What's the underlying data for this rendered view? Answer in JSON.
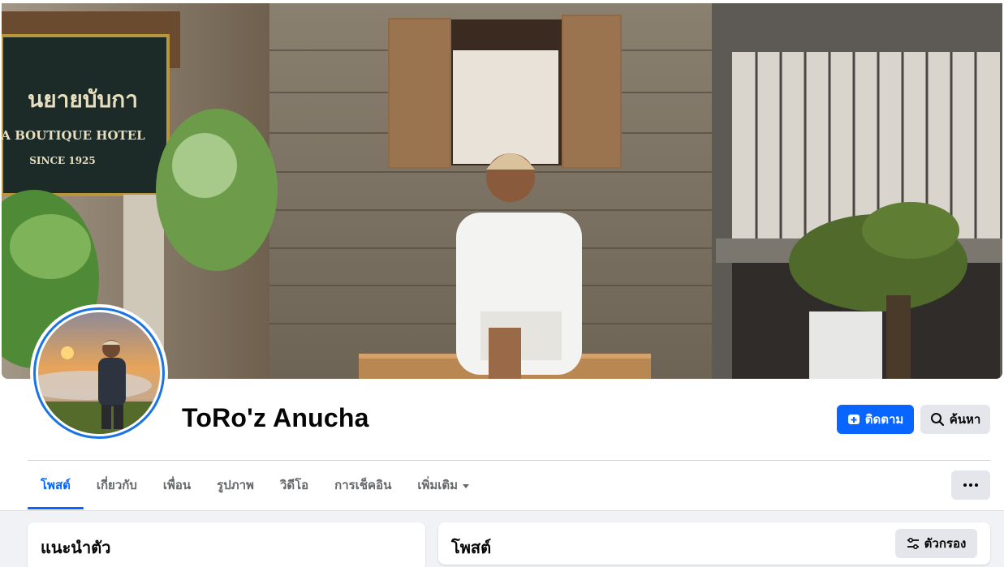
{
  "profile": {
    "name": "ToRo'z Anucha",
    "cover_sign": {
      "line1": "นยายบับกา",
      "line2": "A BOUTIQUE HOTEL",
      "line3": "SINCE 1925"
    }
  },
  "actions": {
    "follow_label": "ติดตาม",
    "search_label": "ค้นหา"
  },
  "tabs": [
    {
      "label": "โพสต์",
      "active": true
    },
    {
      "label": "เกี่ยวกับ"
    },
    {
      "label": "เพื่อน"
    },
    {
      "label": "รูปภาพ"
    },
    {
      "label": "วิดีโอ"
    },
    {
      "label": "การเช็คอิน"
    },
    {
      "label": "เพิ่มเติม"
    }
  ],
  "intro": {
    "title": "แนะนำตัว"
  },
  "posts": {
    "title": "โพสต์",
    "filter_label": "ตัวกรอง"
  },
  "colors": {
    "accent": "#0866ff",
    "secondary_button": "#e4e6eb",
    "page_bg": "#f0f2f5",
    "avatar_ring": "#1b74e4"
  },
  "icons": {
    "follow": "add-friend-icon",
    "search": "search-icon",
    "more": "ellipsis-icon",
    "filter": "filter-sliders-icon",
    "dropdown": "caret-down-icon"
  }
}
